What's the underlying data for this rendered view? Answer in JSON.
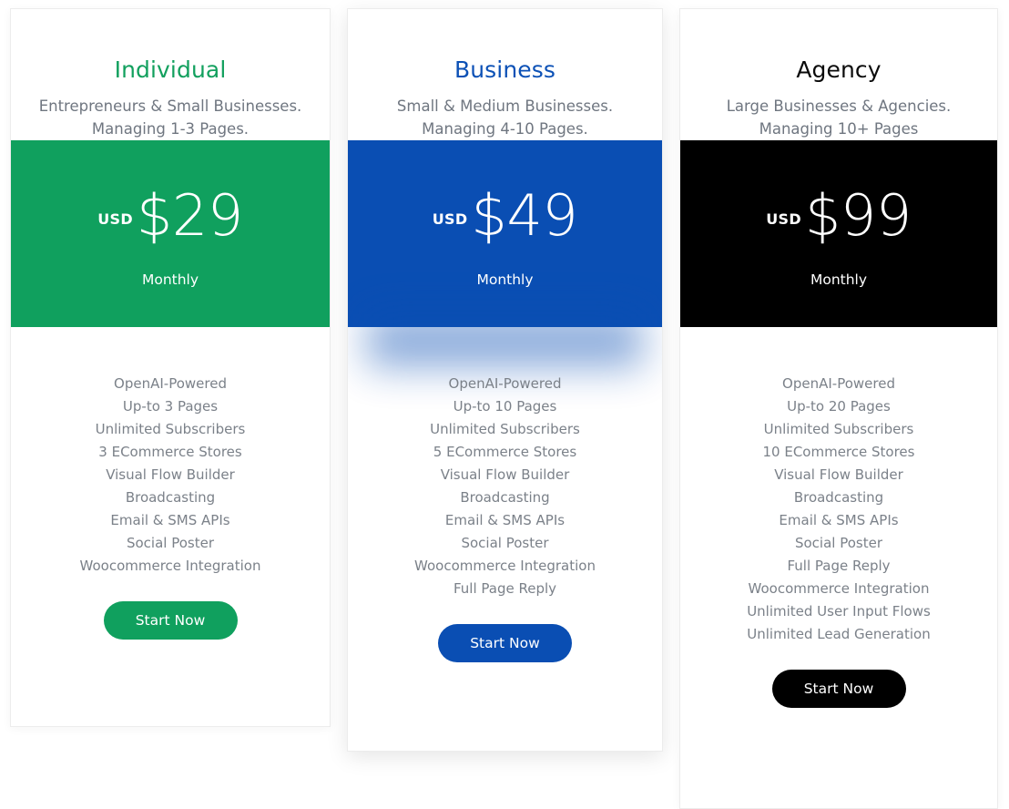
{
  "theme": {
    "green": "#10a05e",
    "blue": "#0a4eb3",
    "black": "#000000",
    "muted_text": "#7b8189",
    "card_bg": "#ffffff",
    "page_bg": "#ffffff"
  },
  "plans": [
    {
      "name": "Individual",
      "tagline": "Entrepreneurs & Small Businesses. Managing 1-3 Pages.",
      "currency": "USD",
      "price": "$29",
      "period": "Monthly",
      "cta_label": "Start Now",
      "accent": "#10a05e",
      "features": [
        "OpenAI-Powered",
        "Up-to 3 Pages",
        "Unlimited Subscribers",
        "3 ECommerce Stores",
        "Visual Flow Builder",
        "Broadcasting",
        "Email & SMS APIs",
        "Social Poster",
        "Woocommerce Integration"
      ]
    },
    {
      "name": "Business",
      "tagline": "Small & Medium Businesses. Managing 4-10 Pages.",
      "currency": "USD",
      "price": "$49",
      "period": "Monthly",
      "cta_label": "Start Now",
      "accent": "#0a4eb3",
      "features": [
        "OpenAI-Powered",
        "Up-to 10 Pages",
        "Unlimited Subscribers",
        "5 ECommerce Stores",
        "Visual Flow Builder",
        "Broadcasting",
        "Email & SMS APIs",
        "Social Poster",
        "Woocommerce Integration",
        "Full Page Reply"
      ]
    },
    {
      "name": "Agency",
      "tagline": "Large Businesses & Agencies. Managing 10+ Pages",
      "currency": "USD",
      "price": "$99",
      "period": "Monthly",
      "cta_label": "Start Now",
      "accent": "#000000",
      "features": [
        "OpenAI-Powered",
        "Up-to 20 Pages",
        "Unlimited Subscribers",
        "10 ECommerce Stores",
        "Visual Flow Builder",
        "Broadcasting",
        "Email & SMS APIs",
        "Social Poster",
        "Full Page Reply",
        "Woocommerce Integration",
        "Unlimited User Input Flows",
        "Unlimited Lead Generation"
      ]
    }
  ]
}
